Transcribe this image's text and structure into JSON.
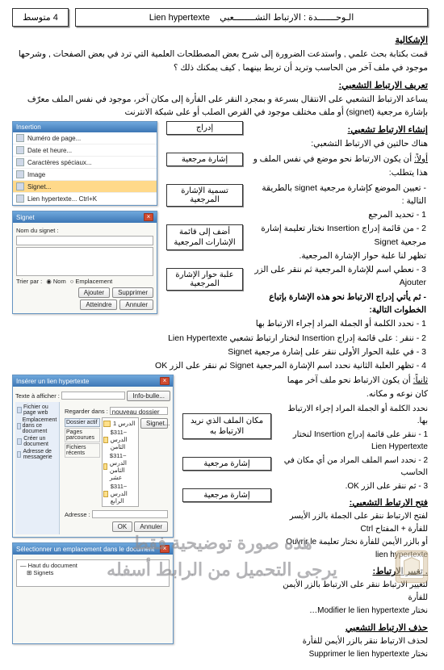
{
  "header": {
    "title_ar": "الـوحـــــــدة : الارتباط التشــــــــعبي",
    "title_fr": "Lien hypertexte",
    "level": "4 متوسط"
  },
  "sections": {
    "problem_title": "الإشكالية",
    "problem_text": "قمت بكتابة بحث علمي , واستدعت الضرورة إلى شرح بعض المصطلحات العلمية التي ترد في بعض الصفحات , وشرحها موجود في ملف آخر من الحاسب وتريد أن تربط بينهما , كيف يمكنك ذلك ؟",
    "definition_title": "تعريف الارتباط التشعبي:",
    "definition_text": "يساعد الارتباط التشعبي على الانتقال بسرعة و بمجرد النقر على الفأرة إلى مكان آخر، موجود في نفس الملف معرّف بإشارة مرجعية (signet) أو ملف مختلف موجود في القرص الصلب أو على شبكة الانترنت",
    "create_title": "إنشاء الارتباط تشعبي:",
    "create_intro": "هناك حالتين في الارتباط التشعبي:",
    "first_case_label": "أولاً:",
    "first_case_text": "أن يكون الارتباط نحو موضع في نفس الملف و هذا يتطلب:",
    "signet_intro": "- تعيين الموضع كإشارة مرجعية signet بالطريقة التالية :",
    "step1": "1 - تحديد المرجع",
    "step2_a": "2 - من قائمة إدراج Insertion نختار تعليمة إشارة مرجعية Signet",
    "step2_b": "تظهر لنا علبة حوار الإشارة المرجعية.",
    "step3": "3 - نعطي اسم للإشارة المرجعية ثم ننقر على الزر Ajouter",
    "then_line": "- ثم يأتي إدراج الارتباط نحو هذه الإشارة بإتباع الخطوات التالية:",
    "s1": "1 - نحدد الكلمة أو الجملة المراد إجراء الارتباط بها",
    "s2": "2 - ننقر : على قائمة إدراج Insertion لنختار ارتباط تشعبي Lien Hypertexte",
    "s3": "3 - في علبة الحوار الأولى ننقر على إشارة مرجعية Signet",
    "s4": "4 - تظهر العلبة الثانية نحدد اسم الإشارة المرجعية Signet ثم ننقر على الزر OK",
    "second_case_label": "ثانياً:",
    "second_case_text": "أن يكون الارتباط نحو ملف آخر مهما كان نوعه و مكانه.",
    "t1": "نحدد الكلمة أو الجملة المراد إجراء الارتباط بها.",
    "t2": "1 - ننقر على قائمة إدراج Insertion لنختار Lien Hypertexte",
    "t3": "2 - نحدد اسم الملف المراد من أي مكان في الحاسب",
    "t4": "3 - ثم ننقر على الزر OK.",
    "open_title": "فتح الارتباط التشعبي:",
    "open_1": "لفتح الارتباط ننقر على الجملة بالزر الأيسر للفأرة + المفتاح Ctrl",
    "open_2": "أو بالزر الأيمن للفأرة نختار تعليمة Ouvrir le lien hypertexte",
    "modify_title": ". تغيير الارتباط:",
    "modify_1": "لتغيير الارتباط ننقر على الارتباط بالزر الأيمن للفأرة",
    "modify_2": "نختار Modifier le lien hypertexte…",
    "delete_title": "حذف الارتباط التشعبي",
    "delete_1": "لحذف الارتباط ننقر بالزر الأيمن للفأرة",
    "delete_2": "نختار Supprimer le lien hypertexte"
  },
  "callouts": {
    "c1": "إدراج",
    "c2": "إشارة مرجعية",
    "c3": "تسمية الإشارة المرجعية",
    "c4": "أضف إلى قائمة الإشارات المرجعية",
    "c5": "علبة حوار الإشارة المرجعية",
    "c6": "مكان الملف الذي نريد الارتباط به",
    "c7": "إشارة مرجعية",
    "c8": "إشارة مرجعية"
  },
  "screenshots": {
    "win1_title": "Insertion",
    "win1_items": [
      "Numéro de page...",
      "Date et heure...",
      "Caractères spéciaux...",
      "Image",
      "Signet...",
      "Lien hypertexte...   Ctrl+K"
    ],
    "win2_title": "Signet",
    "win2_nom": "Nom du signet :",
    "win2_trier": "Trier par :",
    "win2_opt1": "Nom",
    "win2_opt2": "Emplacement",
    "win2_btn_add": "Ajouter",
    "win2_btn_del": "Supprimer",
    "win2_btn_go": "Atteindre",
    "win2_btn_close": "Annuler",
    "win3_title": "Insérer un lien hypertexte",
    "win3_side": [
      "Fichier ou page web",
      "Emplacement dans ce document",
      "Créer un document",
      "Adresse de messagerie"
    ],
    "win3_tabs": [
      "Dossier actif",
      "Pages parcourues",
      "Fichiers récents"
    ],
    "win3_texte": "Texte à afficher :",
    "win3_regarder": "Regarder dans :",
    "win3_opt": "nouveau dossier",
    "win3_rows": [
      "الدرس 1",
      "~$311 الدرس الثامن",
      "~$311 الدرس الثامن عشر",
      "~$311 الدرس الرابع"
    ],
    "win3_btn_signet": "Signet...",
    "win3_btn_info": "Info-bulle...",
    "win3_adresse": "Adresse :",
    "win3_ok": "OK",
    "win3_cancel": "Annuler",
    "win4_title": "Sélectionner un emplacement dans le document",
    "win4_tree1": "Haut du document",
    "win4_tree2": "Signets"
  },
  "watermark": {
    "line1": "هذه صورة توضيحية فقط",
    "line2": "يرجى التحميل من الرابط أسفله"
  }
}
